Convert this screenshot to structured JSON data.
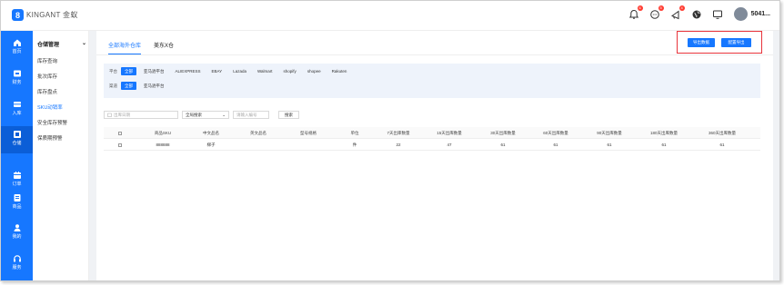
{
  "logo": {
    "mark": "8",
    "brand": "KINGANT",
    "brand_cn": "金蚁"
  },
  "topbar": {
    "icons": [
      {
        "name": "bell-icon",
        "badge": "6"
      },
      {
        "name": "chat-icon",
        "badge": "5"
      },
      {
        "name": "notice-icon",
        "badge": "4"
      },
      {
        "name": "globe-icon",
        "badge": ""
      },
      {
        "name": "monitor-icon",
        "badge": ""
      }
    ],
    "username": "5041..."
  },
  "sidebar": {
    "items": [
      {
        "label": "首页",
        "icon": "home-icon"
      },
      {
        "label": "财务",
        "icon": "finance-icon"
      },
      {
        "label": "入库",
        "icon": "inbound-icon"
      },
      {
        "label": "仓储",
        "icon": "warehouse-icon",
        "active": true
      },
      {
        "label": "订单",
        "icon": "order-icon"
      },
      {
        "label": "商品",
        "icon": "product-icon"
      },
      {
        "label": "我的",
        "icon": "user-icon"
      },
      {
        "label": "服务",
        "icon": "headset-icon"
      }
    ]
  },
  "submenu": {
    "title": "仓储管理",
    "items": [
      "库存查询",
      "批次库存",
      "库存盘点",
      "SKU动销率",
      "安全库存预警",
      "保质期预警"
    ],
    "active_index": 3
  },
  "tabs": [
    "全部海外仓库",
    "美东X仓"
  ],
  "toolbar": {
    "export_data": "导出数据",
    "config_export": "配置导出"
  },
  "filters": {
    "platform_label": "平台",
    "platforms": [
      "全部",
      "亚马逊平台",
      "ALIEXPRESS",
      "EBAY",
      "Lazada",
      "Walmart",
      "shopify",
      "shopee",
      "Rakuten"
    ],
    "channel_label": "渠道",
    "channels": [
      "全部",
      "亚马逊平台"
    ]
  },
  "search": {
    "date_placeholder": "出库日期",
    "mode_value": "全局搜索",
    "keyword_placeholder": "请输入编号",
    "button": "搜索"
  },
  "table": {
    "headers": [
      "商品SKU",
      "中文品名",
      "英文品名",
      "型号规格",
      "单位",
      "7天出库数量",
      "15天出库数量",
      "30天出库数量",
      "60天出库数量",
      "90天出库数量",
      "180天出库数量",
      "360天出库数量"
    ],
    "rows": [
      {
        "sku": "888888",
        "cn_name": "梯子",
        "en_name": "",
        "spec": "",
        "unit": "件",
        "d7": "22",
        "d15": "47",
        "d30": "61",
        "d60": "61",
        "d90": "61",
        "d180": "61",
        "d360": "61"
      }
    ]
  },
  "colors": {
    "accent": "#1677ff",
    "highlight": "#e8343b",
    "sidebar_active": "#0b5ed7"
  }
}
